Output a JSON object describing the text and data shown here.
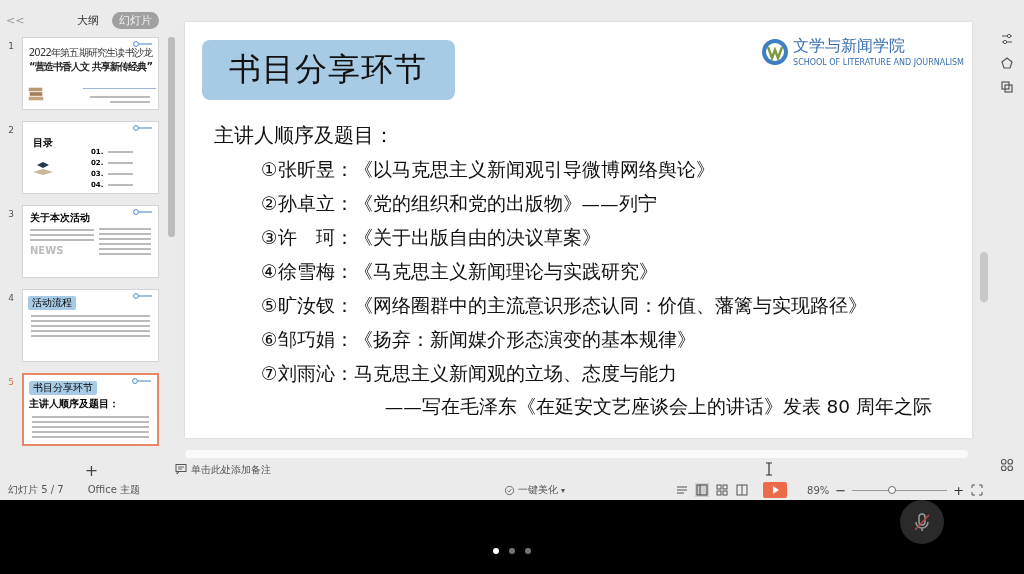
{
  "panel": {
    "collapse": "<<",
    "tabs": [
      {
        "label": "大纲",
        "selected": false
      },
      {
        "label": "幻灯片",
        "selected": true
      }
    ],
    "add": "+"
  },
  "thumbnails": [
    {
      "number": "1",
      "selected": false,
      "kind": "cover",
      "subtitle": "2022年第五期研究生读书沙龙",
      "title": "“营造书香人文 共享新传经典”"
    },
    {
      "number": "2",
      "selected": false,
      "kind": "contents",
      "heading": "目录",
      "items": [
        "01.",
        "02.",
        "03.",
        "04."
      ]
    },
    {
      "number": "3",
      "selected": false,
      "kind": "about",
      "heading": "关于本次活动",
      "word": "NEWS"
    },
    {
      "number": "4",
      "selected": false,
      "kind": "process",
      "heading": "活动流程"
    },
    {
      "number": "5",
      "selected": true,
      "kind": "topics",
      "heading": "书目分享环节",
      "line": "主讲人顺序及题目："
    }
  ],
  "slide": {
    "title": "书目分享环节",
    "logo_name": "文学与新闻学院",
    "logo_subtitle": "SCHOOL OF LITERATURE AND JOURNALISM",
    "intro": "主讲人顺序及题目：",
    "items": [
      "①张昕昱：《以马克思主义新闻观引导微博网络舆论》",
      "②孙卓立：《党的组织和党的出版物》——列宁",
      "③许　珂：《关于出版自由的决议草案》",
      "④徐雪梅：《马克思主义新闻理论与实践研究》",
      "⑤旷汝钗：《网络圈群中的主流意识形态认同：价值、藩篱与实现路径》",
      "⑥邹巧娟：《扬弃：新闻媒介形态演变的基本规律》",
      "⑦刘雨沁：马克思主义新闻观的立场、态度与能力"
    ],
    "closing": "——写在毛泽东《在延安文艺座谈会上的讲话》发表 80 周年之际"
  },
  "notes": {
    "placeholder": "单击此处添加备注"
  },
  "status_bar": {
    "slide_counter": "幻灯片 5 / 7",
    "theme": "Office 主题",
    "beautify": "一键美化",
    "beautify_caret": "▾",
    "zoom": "89%",
    "zoom_slider": {
      "level": 0.42
    },
    "minus": "−",
    "plus": "+"
  },
  "call": {
    "mic_muted": true,
    "pages": [
      {
        "selected": true
      },
      {
        "selected": false
      },
      {
        "selected": false
      }
    ]
  }
}
